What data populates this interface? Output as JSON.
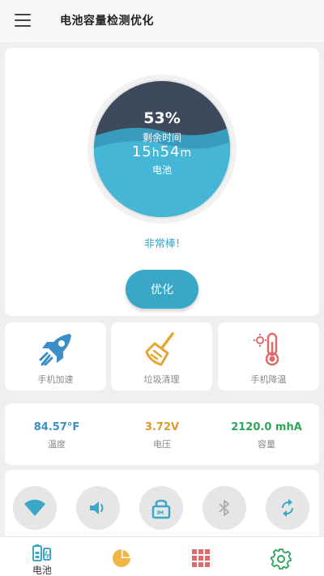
{
  "header": {
    "title": "电池容量检测优化"
  },
  "gauge": {
    "percent": "53%",
    "level": 0.53,
    "remaining_label": "剩余时间",
    "hours": "15",
    "h_unit": "h",
    "minutes": "54",
    "m_unit": "m",
    "name": "电池"
  },
  "status": "非常棒!",
  "optimize_label": "优化",
  "tools": [
    {
      "label": "手机加速",
      "icon": "rocket-icon"
    },
    {
      "label": "垃圾清理",
      "icon": "broom-icon"
    },
    {
      "label": "手机降温",
      "icon": "thermometer-icon"
    }
  ],
  "stats": [
    {
      "value": "84.57°F",
      "label": "温度",
      "color": "#3a8fc7"
    },
    {
      "value": "3.72V",
      "label": "电压",
      "color": "#e39a2a"
    },
    {
      "value": "2120.0 mhA",
      "label": "容量",
      "color": "#2ea55a"
    }
  ],
  "toggles": [
    "wifi-icon",
    "volume-icon",
    "lock-rotation-icon",
    "bluetooth-icon",
    "sync-icon"
  ],
  "nav": {
    "battery_label": "电池",
    "items": [
      "battery-icon",
      "pie-chart-icon",
      "apps-grid-icon",
      "settings-gear-icon"
    ]
  },
  "colors": {
    "accent": "#3aa7c7",
    "dark_wave": "#3d4a5c",
    "light_wave": "#45b6d6"
  }
}
